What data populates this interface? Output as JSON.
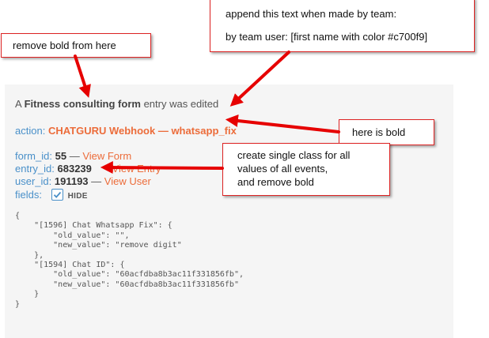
{
  "entry": {
    "prefix": "A",
    "form_name": "Fitness consulting form",
    "suffix": "entry was edited",
    "action_key": "action:",
    "action_value": "CHATGURU Webhook — whatsapp_fix",
    "form_id_key": "form_id:",
    "form_id_value": "55",
    "form_id_sep": "—",
    "form_id_link": "View Form",
    "entry_id_key": "entry_id:",
    "entry_id_value": "683239",
    "entry_id_link": "View Entry",
    "user_id_key": "user_id:",
    "user_id_value": "191193",
    "user_id_sep": "—",
    "user_id_link": "View User",
    "fields_key": "fields:",
    "fields_toggle": "HIDE",
    "json_text": "{\n    \"[1596] Chat Whatsapp Fix\": {\n        \"old_value\": \"\",\n        \"new_value\": \"remove digit\"\n    },\n    \"[1594] Chat ID\": {\n        \"old_value\": \"60acfdba8b3ac11f331856fb\",\n        \"new_value\": \"60acfdba8b3ac11f331856fb\"\n    }\n}"
  },
  "annotations": {
    "append_line1": "append this text when made by team:",
    "append_line2": "by team user: [first name with color #c700f9]",
    "remove_bold": "remove bold from here",
    "here_bold": "here is bold",
    "single_class_1": "create single class for all",
    "single_class_2": "values of all events,",
    "single_class_3": "and remove bold"
  },
  "colors": {
    "accent_orange": "#ec6c3a",
    "key_blue": "#4a90c9",
    "annotation_red": "#e60000",
    "card_bg": "#f5f5f5"
  }
}
